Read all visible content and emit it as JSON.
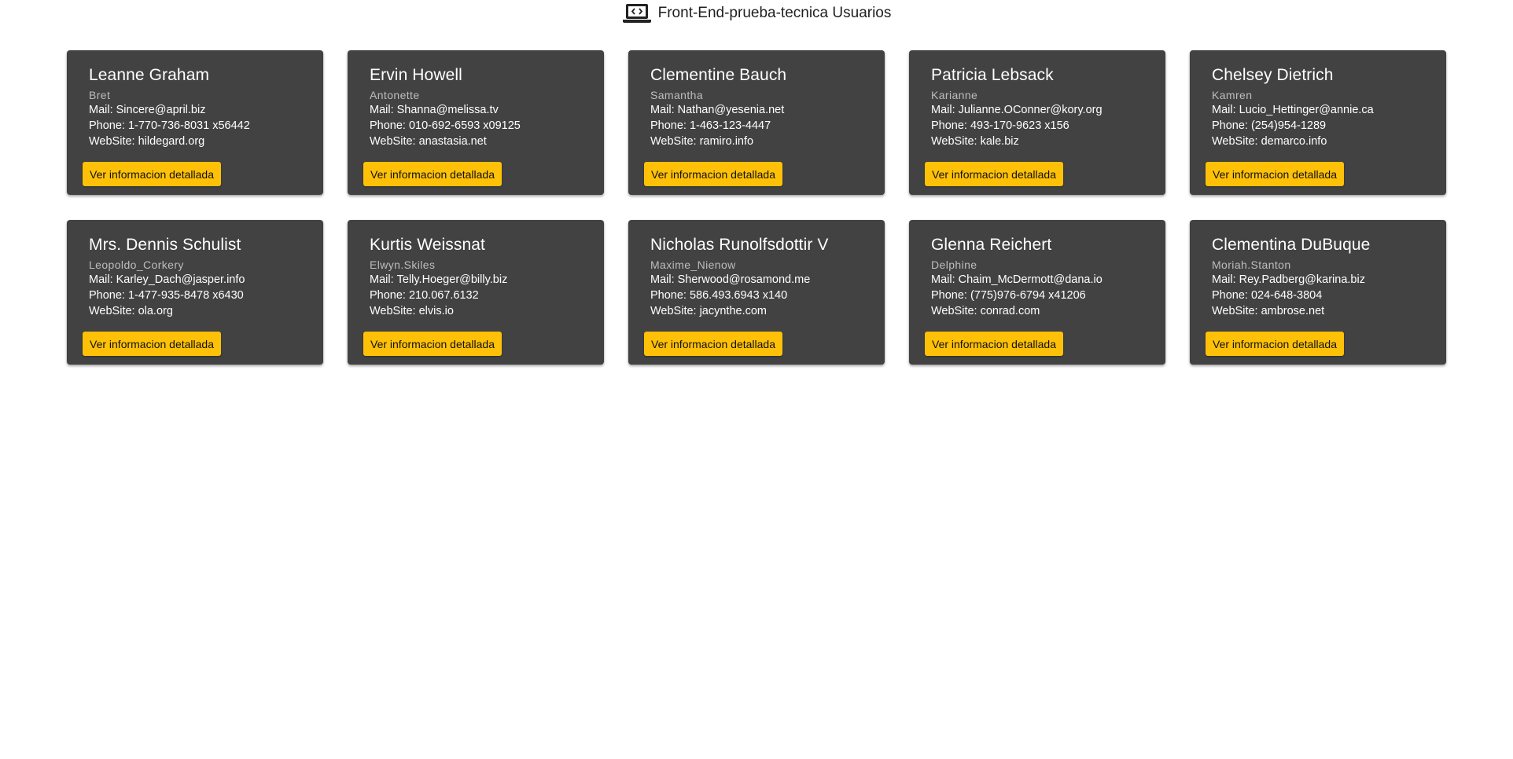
{
  "header": {
    "title": "Front-End-prueba-tecnica Usuarios",
    "icon": "laptop-code-icon"
  },
  "labels": {
    "mail": "Mail:",
    "phone": "Phone:",
    "website": "WebSite:"
  },
  "colors": {
    "card_bg": "#424242",
    "button_bg": "#ffc107"
  },
  "users": [
    {
      "name": "Leanne Graham",
      "username": "Bret",
      "email": "Sincere@april.biz",
      "phone": "1-770-736-8031 x56442",
      "website": "hildegard.org",
      "button": "Ver informacion detallada"
    },
    {
      "name": "Ervin Howell",
      "username": "Antonette",
      "email": "Shanna@melissa.tv",
      "phone": "010-692-6593 x09125",
      "website": "anastasia.net",
      "button": "Ver informacion detallada"
    },
    {
      "name": "Clementine Bauch",
      "username": "Samantha",
      "email": "Nathan@yesenia.net",
      "phone": "1-463-123-4447",
      "website": "ramiro.info",
      "button": "Ver informacion detallada"
    },
    {
      "name": "Patricia Lebsack",
      "username": "Karianne",
      "email": "Julianne.OConner@kory.org",
      "phone": "493-170-9623 x156",
      "website": "kale.biz",
      "button": "Ver informacion detallada"
    },
    {
      "name": "Chelsey Dietrich",
      "username": "Kamren",
      "email": "Lucio_Hettinger@annie.ca",
      "phone": "(254)954-1289",
      "website": "demarco.info",
      "button": "Ver informacion detallada"
    },
    {
      "name": "Mrs. Dennis Schulist",
      "username": "Leopoldo_Corkery",
      "email": "Karley_Dach@jasper.info",
      "phone": "1-477-935-8478 x6430",
      "website": "ola.org",
      "button": "Ver informacion detallada"
    },
    {
      "name": "Kurtis Weissnat",
      "username": "Elwyn.Skiles",
      "email": "Telly.Hoeger@billy.biz",
      "phone": "210.067.6132",
      "website": "elvis.io",
      "button": "Ver informacion detallada"
    },
    {
      "name": "Nicholas Runolfsdottir V",
      "username": "Maxime_Nienow",
      "email": "Sherwood@rosamond.me",
      "phone": "586.493.6943 x140",
      "website": "jacynthe.com",
      "button": "Ver informacion detallada"
    },
    {
      "name": "Glenna Reichert",
      "username": "Delphine",
      "email": "Chaim_McDermott@dana.io",
      "phone": "(775)976-6794 x41206",
      "website": "conrad.com",
      "button": "Ver informacion detallada"
    },
    {
      "name": "Clementina DuBuque",
      "username": "Moriah.Stanton",
      "email": "Rey.Padberg@karina.biz",
      "phone": "024-648-3804",
      "website": "ambrose.net",
      "button": "Ver informacion detallada"
    }
  ]
}
